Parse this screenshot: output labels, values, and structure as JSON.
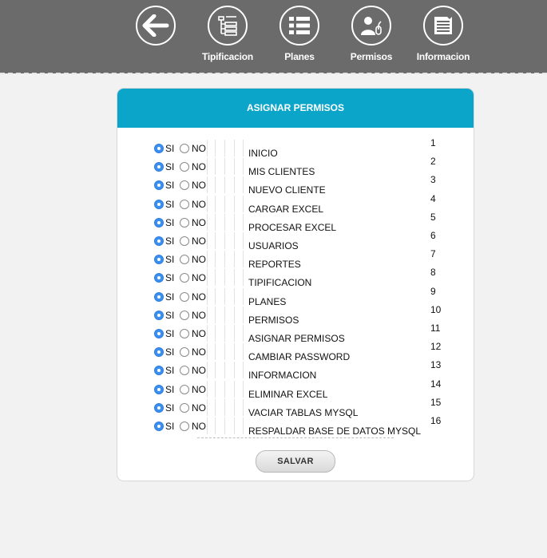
{
  "nav": [
    {
      "label": "",
      "icon": "back-arrow-icon"
    },
    {
      "label": "Tipificacion",
      "icon": "tree-list-icon"
    },
    {
      "label": "Planes",
      "icon": "list-icon"
    },
    {
      "label": "Permisos",
      "icon": "user-permissions-icon"
    },
    {
      "label": "Informacion",
      "icon": "document-icon"
    }
  ],
  "panel": {
    "title": "ASIGNAR PERMISOS",
    "option_yes": "SI",
    "option_no": "NO",
    "save_label": "SALVAR",
    "permissions": [
      {
        "name": "INICIO",
        "number": "1",
        "selected": "SI"
      },
      {
        "name": "MIS CLIENTES",
        "number": "2",
        "selected": "SI"
      },
      {
        "name": "NUEVO CLIENTE",
        "number": "3",
        "selected": "SI"
      },
      {
        "name": "CARGAR EXCEL",
        "number": "4",
        "selected": "SI"
      },
      {
        "name": "PROCESAR EXCEL",
        "number": "5",
        "selected": "SI"
      },
      {
        "name": "USUARIOS",
        "number": "6",
        "selected": "SI"
      },
      {
        "name": "REPORTES",
        "number": "7",
        "selected": "SI"
      },
      {
        "name": "TIPIFICACION",
        "number": "8",
        "selected": "SI"
      },
      {
        "name": "PLANES",
        "number": "9",
        "selected": "SI"
      },
      {
        "name": "PERMISOS",
        "number": "10",
        "selected": "SI"
      },
      {
        "name": "ASIGNAR PERMISOS",
        "number": "11",
        "selected": "SI"
      },
      {
        "name": "CAMBIAR PASSWORD",
        "number": "12",
        "selected": "SI"
      },
      {
        "name": "INFORMACION",
        "number": "13",
        "selected": "SI"
      },
      {
        "name": "ELIMINAR EXCEL",
        "number": "14",
        "selected": "SI"
      },
      {
        "name": "VACIAR TABLAS MYSQL",
        "number": "15",
        "selected": "SI"
      },
      {
        "name": "RESPALDAR BASE DE DATOS MYSQL",
        "number": "16",
        "selected": "SI"
      }
    ]
  },
  "colors": {
    "topbar": "#6b6b6b",
    "header": "#0aa5c9",
    "radio_selected": "#3b8ff0"
  }
}
